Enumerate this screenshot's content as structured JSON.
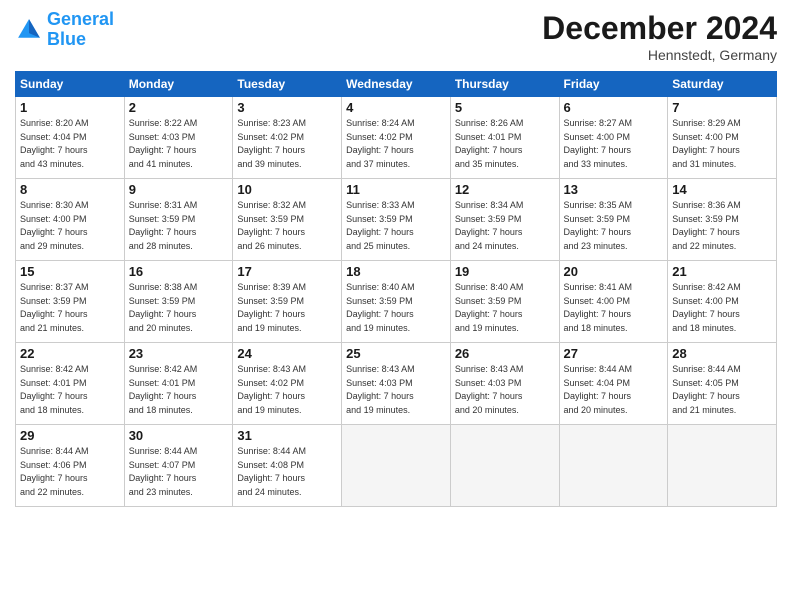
{
  "header": {
    "logo_line1": "General",
    "logo_line2": "Blue",
    "month_title": "December 2024",
    "location": "Hennstedt, Germany"
  },
  "weekdays": [
    "Sunday",
    "Monday",
    "Tuesday",
    "Wednesday",
    "Thursday",
    "Friday",
    "Saturday"
  ],
  "weeks": [
    [
      {
        "day": "1",
        "info": "Sunrise: 8:20 AM\nSunset: 4:04 PM\nDaylight: 7 hours\nand 43 minutes."
      },
      {
        "day": "2",
        "info": "Sunrise: 8:22 AM\nSunset: 4:03 PM\nDaylight: 7 hours\nand 41 minutes."
      },
      {
        "day": "3",
        "info": "Sunrise: 8:23 AM\nSunset: 4:02 PM\nDaylight: 7 hours\nand 39 minutes."
      },
      {
        "day": "4",
        "info": "Sunrise: 8:24 AM\nSunset: 4:02 PM\nDaylight: 7 hours\nand 37 minutes."
      },
      {
        "day": "5",
        "info": "Sunrise: 8:26 AM\nSunset: 4:01 PM\nDaylight: 7 hours\nand 35 minutes."
      },
      {
        "day": "6",
        "info": "Sunrise: 8:27 AM\nSunset: 4:00 PM\nDaylight: 7 hours\nand 33 minutes."
      },
      {
        "day": "7",
        "info": "Sunrise: 8:29 AM\nSunset: 4:00 PM\nDaylight: 7 hours\nand 31 minutes."
      }
    ],
    [
      {
        "day": "8",
        "info": "Sunrise: 8:30 AM\nSunset: 4:00 PM\nDaylight: 7 hours\nand 29 minutes."
      },
      {
        "day": "9",
        "info": "Sunrise: 8:31 AM\nSunset: 3:59 PM\nDaylight: 7 hours\nand 28 minutes."
      },
      {
        "day": "10",
        "info": "Sunrise: 8:32 AM\nSunset: 3:59 PM\nDaylight: 7 hours\nand 26 minutes."
      },
      {
        "day": "11",
        "info": "Sunrise: 8:33 AM\nSunset: 3:59 PM\nDaylight: 7 hours\nand 25 minutes."
      },
      {
        "day": "12",
        "info": "Sunrise: 8:34 AM\nSunset: 3:59 PM\nDaylight: 7 hours\nand 24 minutes."
      },
      {
        "day": "13",
        "info": "Sunrise: 8:35 AM\nSunset: 3:59 PM\nDaylight: 7 hours\nand 23 minutes."
      },
      {
        "day": "14",
        "info": "Sunrise: 8:36 AM\nSunset: 3:59 PM\nDaylight: 7 hours\nand 22 minutes."
      }
    ],
    [
      {
        "day": "15",
        "info": "Sunrise: 8:37 AM\nSunset: 3:59 PM\nDaylight: 7 hours\nand 21 minutes."
      },
      {
        "day": "16",
        "info": "Sunrise: 8:38 AM\nSunset: 3:59 PM\nDaylight: 7 hours\nand 20 minutes."
      },
      {
        "day": "17",
        "info": "Sunrise: 8:39 AM\nSunset: 3:59 PM\nDaylight: 7 hours\nand 19 minutes."
      },
      {
        "day": "18",
        "info": "Sunrise: 8:40 AM\nSunset: 3:59 PM\nDaylight: 7 hours\nand 19 minutes."
      },
      {
        "day": "19",
        "info": "Sunrise: 8:40 AM\nSunset: 3:59 PM\nDaylight: 7 hours\nand 19 minutes."
      },
      {
        "day": "20",
        "info": "Sunrise: 8:41 AM\nSunset: 4:00 PM\nDaylight: 7 hours\nand 18 minutes."
      },
      {
        "day": "21",
        "info": "Sunrise: 8:42 AM\nSunset: 4:00 PM\nDaylight: 7 hours\nand 18 minutes."
      }
    ],
    [
      {
        "day": "22",
        "info": "Sunrise: 8:42 AM\nSunset: 4:01 PM\nDaylight: 7 hours\nand 18 minutes."
      },
      {
        "day": "23",
        "info": "Sunrise: 8:42 AM\nSunset: 4:01 PM\nDaylight: 7 hours\nand 18 minutes."
      },
      {
        "day": "24",
        "info": "Sunrise: 8:43 AM\nSunset: 4:02 PM\nDaylight: 7 hours\nand 19 minutes."
      },
      {
        "day": "25",
        "info": "Sunrise: 8:43 AM\nSunset: 4:03 PM\nDaylight: 7 hours\nand 19 minutes."
      },
      {
        "day": "26",
        "info": "Sunrise: 8:43 AM\nSunset: 4:03 PM\nDaylight: 7 hours\nand 20 minutes."
      },
      {
        "day": "27",
        "info": "Sunrise: 8:44 AM\nSunset: 4:04 PM\nDaylight: 7 hours\nand 20 minutes."
      },
      {
        "day": "28",
        "info": "Sunrise: 8:44 AM\nSunset: 4:05 PM\nDaylight: 7 hours\nand 21 minutes."
      }
    ],
    [
      {
        "day": "29",
        "info": "Sunrise: 8:44 AM\nSunset: 4:06 PM\nDaylight: 7 hours\nand 22 minutes."
      },
      {
        "day": "30",
        "info": "Sunrise: 8:44 AM\nSunset: 4:07 PM\nDaylight: 7 hours\nand 23 minutes."
      },
      {
        "day": "31",
        "info": "Sunrise: 8:44 AM\nSunset: 4:08 PM\nDaylight: 7 hours\nand 24 minutes."
      },
      {
        "day": "",
        "info": ""
      },
      {
        "day": "",
        "info": ""
      },
      {
        "day": "",
        "info": ""
      },
      {
        "day": "",
        "info": ""
      }
    ]
  ]
}
